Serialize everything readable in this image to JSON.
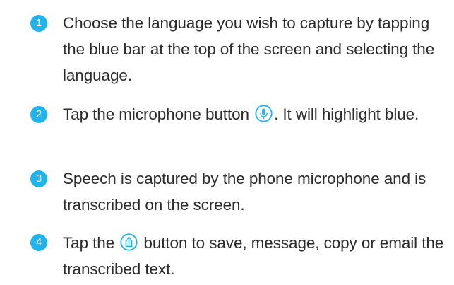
{
  "colors": {
    "accent": "#21b4ec",
    "text": "#2b2b2b"
  },
  "steps": [
    {
      "number": "1",
      "text": "Choose the language you wish to capture by tapping the blue bar at the top of the screen and selecting the language."
    },
    {
      "number": "2",
      "text_before_icon": "Tap the microphone button ",
      "icon": "microphone-icon",
      "text_after_icon": ". It will highlight blue."
    },
    {
      "number": "3",
      "text": "Speech is captured by the phone microphone and is transcribed on the screen."
    },
    {
      "number": "4",
      "text_before_icon": "Tap the ",
      "icon": "share-icon",
      "text_after_icon": " button to save, message, copy or email the transcribed text."
    }
  ]
}
